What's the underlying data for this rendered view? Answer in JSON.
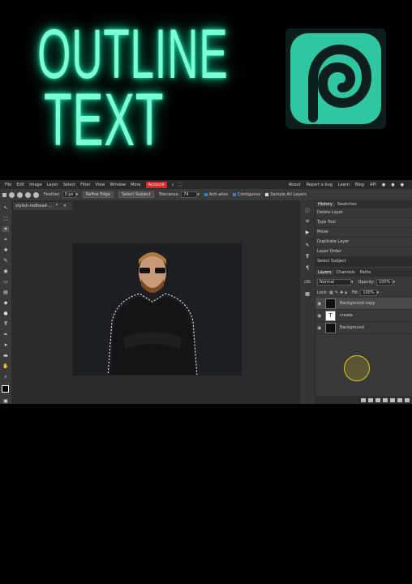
{
  "hero": {
    "line1": "OUTLINE",
    "line2": "TEXT",
    "accent": "#7dffd6",
    "logo_color": "#2ec7a2"
  },
  "menubar": {
    "items": [
      "File",
      "Edit",
      "Image",
      "Layer",
      "Select",
      "Filter",
      "View",
      "Window",
      "More"
    ],
    "account": "Account",
    "right_items": [
      "About",
      "Report a bug",
      "Learn",
      "Blog",
      "API"
    ]
  },
  "tool_options": {
    "feather_label": "Feather:",
    "feather_value": "0 px",
    "refine_edge": "Refine Edge",
    "select_subject": "Select Subject",
    "tolerance_label": "Tolerance:",
    "tolerance_value": "74",
    "anti_alias": "Anti-alias",
    "contiguous": "Contiguous",
    "sample_all": "Sample All Layers"
  },
  "document": {
    "tab": "stylish-redhead-...",
    "modified": "*",
    "close": "×"
  },
  "history": {
    "tabs": [
      "History",
      "Swatches"
    ],
    "items": [
      "Delete Layer",
      "Type Tool",
      "Move",
      "Duplicate Layer",
      "Layer Order",
      "Select Subject"
    ]
  },
  "layers_panel": {
    "tabs": [
      "Layers",
      "Channels",
      "Paths"
    ],
    "blend_mode": "Normal",
    "opacity_label": "Opacity:",
    "opacity_value": "100%",
    "lock_label": "Lock:",
    "fill_label": "Fill:",
    "fill_value": "100%",
    "layers": [
      {
        "name": "Background copy",
        "selected": true
      },
      {
        "name": "create",
        "selected": false,
        "thumb": "T"
      },
      {
        "name": "Background",
        "selected": false
      }
    ]
  },
  "side_icons": {
    "css": "CSS"
  }
}
